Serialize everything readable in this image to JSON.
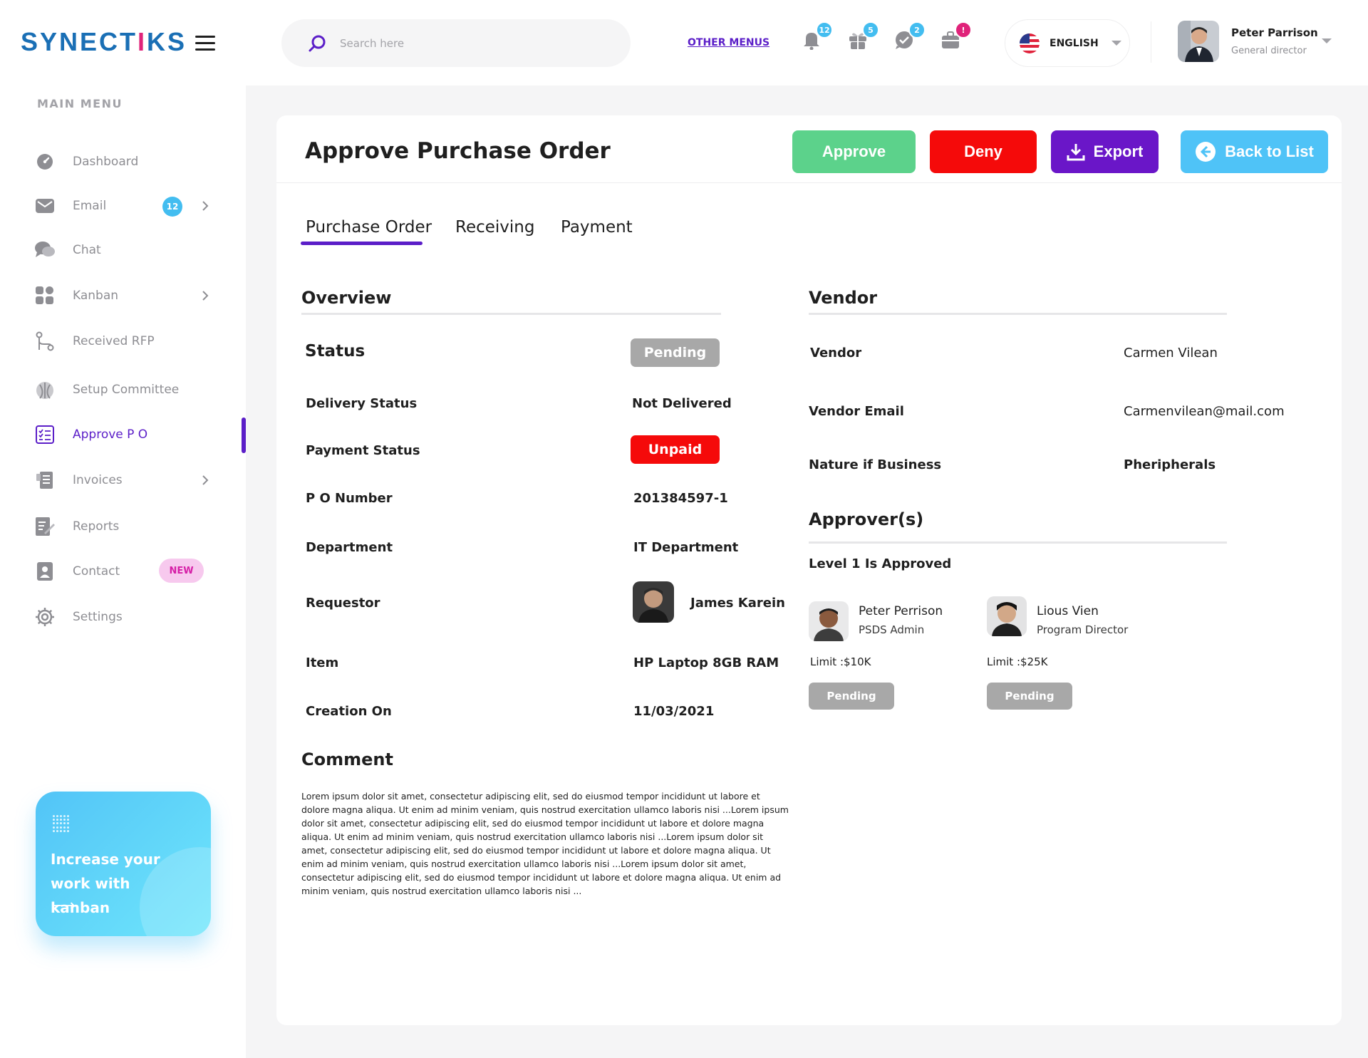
{
  "brand": {
    "logo_pre": "SYNECT",
    "logo_hl": "I",
    "logo_post": "KS",
    "accent": "#5b1ec8"
  },
  "sidebar": {
    "title": "MAIN MENU",
    "items": [
      {
        "label": "Dashboard",
        "icon": "dashboard-icon"
      },
      {
        "label": "Email",
        "icon": "email-icon",
        "badge": "12"
      },
      {
        "label": "Chat",
        "icon": "chat-icon"
      },
      {
        "label": "Kanban",
        "icon": "kanban-icon"
      },
      {
        "label": "Received RFP",
        "icon": "rfp-icon"
      },
      {
        "label": "Setup Committee",
        "icon": "committee-icon"
      },
      {
        "label": "Approve P O",
        "icon": "approve-po-icon"
      },
      {
        "label": "Invoices",
        "icon": "invoices-icon"
      },
      {
        "label": "Reports",
        "icon": "reports-icon"
      },
      {
        "label": "Contact",
        "icon": "contact-icon",
        "badge": "NEW"
      },
      {
        "label": "Settings",
        "icon": "settings-icon"
      }
    ],
    "promo": {
      "line1": "Increase your",
      "line2": "work with kanban",
      "arrow": "⟶"
    }
  },
  "topbar": {
    "search_placeholder": "Search here",
    "other_menus": "OTHER MENUS",
    "notifications": {
      "bell": "12",
      "gift": "5",
      "chat": "2",
      "briefcase": "!"
    },
    "language": "ENGLISH",
    "user": {
      "name": "Peter Parrison",
      "role": "General director"
    }
  },
  "page": {
    "title": "Approve Purchase Order",
    "actions": {
      "approve": "Approve",
      "deny": "Deny",
      "export": "Export",
      "back": "Back to List"
    },
    "tabs": [
      "Purchase Order",
      "Receiving",
      "Payment"
    ]
  },
  "overview": {
    "title": "Overview",
    "status_label": "Status",
    "status_value": "Pending",
    "rows": [
      {
        "label": "Delivery Status",
        "value": "Not Delivered"
      },
      {
        "label": "Payment Status",
        "value": "Unpaid"
      },
      {
        "label": "P O Number",
        "value": "201384597-1"
      },
      {
        "label": "Department",
        "value": "IT Department"
      },
      {
        "label": "Requestor",
        "value": "James Karein"
      },
      {
        "label": "Item",
        "value": "HP Laptop 8GB RAM"
      },
      {
        "label": "Creation On",
        "value": "11/03/2021"
      }
    ]
  },
  "vendor": {
    "title": "Vendor",
    "rows": [
      {
        "label": "Vendor",
        "value": "Carmen Vilean"
      },
      {
        "label": "Vendor Email",
        "value": "Carmenvilean@mail.com"
      },
      {
        "label": "Nature if Business",
        "value": "Pheripherals"
      }
    ]
  },
  "approvers": {
    "title": "Approver(s)",
    "level": "Level 1 Is Approved",
    "list": [
      {
        "name": "Peter Perrison",
        "role": "PSDS Admin",
        "limit": "Limit :$10K",
        "status": "Pending"
      },
      {
        "name": "Lious Vien",
        "role": "Program Director",
        "limit": "Limit :$25K",
        "status": "Pending"
      }
    ]
  },
  "comment": {
    "title": "Comment",
    "text": "Lorem ipsum dolor sit amet, consectetur adipiscing elit, sed do eiusmod tempor incididunt ut labore et dolore magna aliqua. Ut enim ad minim veniam, quis nostrud exercitation ullamco laboris nisi ...Lorem ipsum dolor sit amet, consectetur adipiscing elit, sed do eiusmod tempor incididunt ut labore et dolore magna aliqua. Ut enim ad minim veniam, quis nostrud exercitation ullamco laboris nisi ...Lorem ipsum dolor sit amet, consectetur adipiscing elit, sed do eiusmod tempor incididunt ut labore et dolore magna aliqua. Ut enim ad minim veniam, quis nostrud exercitation ullamco laboris nisi ...Lorem ipsum dolor sit amet, consectetur adipiscing elit, sed do eiusmod tempor incididunt ut labore et dolore magna aliqua. Ut enim ad minim veniam, quis nostrud exercitation ullamco laboris nisi ..."
  }
}
